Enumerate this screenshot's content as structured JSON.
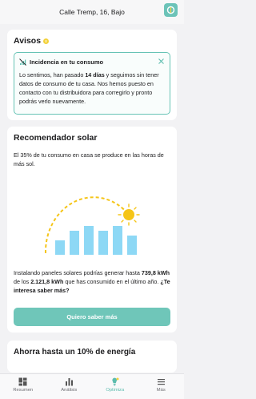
{
  "header": {
    "title": "Calle Tremp, 16, Bajo"
  },
  "avisos": {
    "title": "Avisos",
    "alert": {
      "title": "Incidencia en tu consumo",
      "text_before": "Lo sentimos, han pasado ",
      "text_bold": "14 días",
      "text_after": " y seguimos sin tener datos de consumo de tu casa. Nos hemos puesto en contacto con tu distribuidora para corregirlo y pronto podrás verlo nuevamente."
    }
  },
  "solar": {
    "title": "Recomendador solar",
    "intro": "El 35% de tu consumo en casa se produce en las horas de más sol.",
    "body_before": "Instalando paneles solares podrías generar hasta ",
    "body_bold1": "739,8 kWh",
    "body_mid": " de los ",
    "body_bold2": "2.121,8 kWh",
    "body_after": " que has consumido en el último año. ",
    "body_bold3": "¿Te interesa saber más?",
    "cta": "Quiero saber más"
  },
  "ahorra": {
    "title": "Ahorra hasta un 10% de energía"
  },
  "tabs": [
    {
      "label": "Resumen",
      "icon": "dashboard-icon",
      "active": false
    },
    {
      "label": "Análisis",
      "icon": "bar-chart-icon",
      "active": false
    },
    {
      "label": "Optimiza",
      "icon": "lightbulb-icon",
      "active": true
    },
    {
      "label": "Más",
      "icon": "menu-icon",
      "active": false
    }
  ],
  "colors": {
    "accent": "#6fc6b9",
    "sun": "#f5c518",
    "bars": "#8dd8f5",
    "background": "#f2f2f4"
  }
}
